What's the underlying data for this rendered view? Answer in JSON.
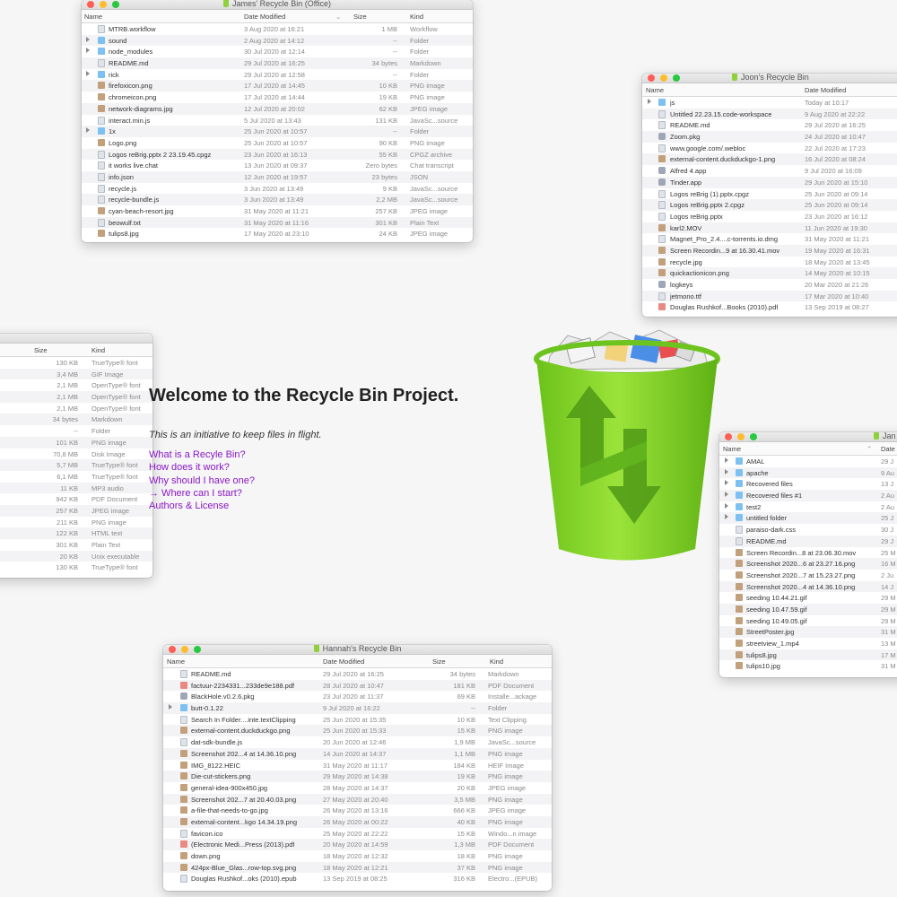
{
  "page": {
    "heading": "Welcome to the Recycle Bin Project.",
    "tagline": "This is an initiative to keep files in flight.",
    "links": [
      "What is a Recyle Bin?",
      "How does it work?",
      "Why should I have one?",
      "→ Where can I start?",
      "Authors & License"
    ],
    "accent_color": "#8a17c7"
  },
  "windows": {
    "james": {
      "title": "James' Recycle Bin (Office)",
      "columns": [
        "Name",
        "Date Modified",
        "Size",
        "Kind"
      ],
      "rows": [
        {
          "icon": "file",
          "name": "MTRB.workflow",
          "date": "3 Aug 2020 at 16:21",
          "size": "1 MB",
          "kind": "Workflow"
        },
        {
          "icon": "folder",
          "name": "sound",
          "date": "2 Aug 2020 at 14:12",
          "size": "--",
          "kind": "Folder"
        },
        {
          "icon": "folder",
          "name": "node_modules",
          "date": "30 Jul 2020 at 12:14",
          "size": "--",
          "kind": "Folder"
        },
        {
          "icon": "file",
          "name": "README.md",
          "date": "29 Jul 2020 at 16:25",
          "size": "34 bytes",
          "kind": "Markdown"
        },
        {
          "icon": "folder",
          "name": "rick",
          "date": "29 Jul 2020 at 12:58",
          "size": "--",
          "kind": "Folder"
        },
        {
          "icon": "img",
          "name": "firefoxicon.png",
          "date": "17 Jul 2020 at 14:45",
          "size": "10 KB",
          "kind": "PNG image"
        },
        {
          "icon": "img",
          "name": "chromeicon.png",
          "date": "17 Jul 2020 at 14:44",
          "size": "19 KB",
          "kind": "PNG image"
        },
        {
          "icon": "img",
          "name": "network-diagrams.jpg",
          "date": "12 Jul 2020 at 20:02",
          "size": "62 KB",
          "kind": "JPEG image"
        },
        {
          "icon": "file",
          "name": "interact.min.js",
          "date": "5 Jul 2020 at 13:43",
          "size": "131 KB",
          "kind": "JavaSc...source"
        },
        {
          "icon": "folder",
          "name": "1x",
          "date": "25 Jun 2020 at 10:57",
          "size": "--",
          "kind": "Folder"
        },
        {
          "icon": "img",
          "name": "Logo.png",
          "date": "25 Jun 2020 at 10:57",
          "size": "90 KB",
          "kind": "PNG image"
        },
        {
          "icon": "file",
          "name": "Logos reBrig.pptx 2 23.19.45.cpgz",
          "date": "23 Jun 2020 at 16:13",
          "size": "55 KB",
          "kind": "CPGZ archive"
        },
        {
          "icon": "file",
          "name": "it works live.chat",
          "date": "13 Jun 2020 at 09:37",
          "size": "Zero bytes",
          "kind": "Chat transcript"
        },
        {
          "icon": "file",
          "name": "info.json",
          "date": "12 Jun 2020 at 19:57",
          "size": "23 bytes",
          "kind": "JSON"
        },
        {
          "icon": "file",
          "name": "recycle.js",
          "date": "3 Jun 2020 at 13:49",
          "size": "9 KB",
          "kind": "JavaSc...source"
        },
        {
          "icon": "file",
          "name": "recycle-bundle.js",
          "date": "3 Jun 2020 at 13:49",
          "size": "2,2 MB",
          "kind": "JavaSc...source"
        },
        {
          "icon": "img",
          "name": "cyan-beach-resort.jpg",
          "date": "31 May 2020 at 11:21",
          "size": "257 KB",
          "kind": "JPEG image"
        },
        {
          "icon": "file",
          "name": "beowulf.txt",
          "date": "31 May 2020 at 11:16",
          "size": "301 KB",
          "kind": "Plain Text"
        },
        {
          "icon": "img",
          "name": "tulips8.jpg",
          "date": "17 May 2020 at 23:10",
          "size": "24 KB",
          "kind": "JPEG image"
        }
      ]
    },
    "joon": {
      "title": "Joon's Recycle Bin",
      "columns": [
        "Name",
        "Date Modified"
      ],
      "rows": [
        {
          "icon": "folder",
          "name": "js",
          "date": "Today at 10:17"
        },
        {
          "icon": "file",
          "name": "Untitled 22.23.15.code-workspace",
          "date": "9 Aug 2020 at 22:22"
        },
        {
          "icon": "file",
          "name": "README.md",
          "date": "29 Jul 2020 at 16:25"
        },
        {
          "icon": "app",
          "name": "Zoom.pkg",
          "date": "24 Jul 2020 at 10:47"
        },
        {
          "icon": "file",
          "name": "www.google.com/.webloc",
          "date": "22 Jul 2020 at 17:23"
        },
        {
          "icon": "img",
          "name": "external-content.duckduckgo-1.png",
          "date": "16 Jul 2020 at 08:24"
        },
        {
          "icon": "app",
          "name": "Alfred 4.app",
          "date": "9 Jul 2020 at 16:09"
        },
        {
          "icon": "app",
          "name": "Tinder.app",
          "date": "29 Jun 2020 at 15:10"
        },
        {
          "icon": "file",
          "name": "Logos reBrig (1).pptx.cpgz",
          "date": "25 Jun 2020 at 09:14"
        },
        {
          "icon": "file",
          "name": "Logos reBrig.pptx 2.cpgz",
          "date": "25 Jun 2020 at 09:14"
        },
        {
          "icon": "file",
          "name": "Logos reBrig.pptx",
          "date": "23 Jun 2020 at 16:12"
        },
        {
          "icon": "img",
          "name": "karl2.MOV",
          "date": "11 Jun 2020 at 19:30"
        },
        {
          "icon": "file",
          "name": "Magnet_Pro_2.4....c-torrents.io.dmg",
          "date": "31 May 2020 at 11:21"
        },
        {
          "icon": "img",
          "name": "Screen Recordin...9 at 16.30.41.mov",
          "date": "19 May 2020 at 16:31"
        },
        {
          "icon": "img",
          "name": "recycle.jpg",
          "date": "18 May 2020 at 13:45"
        },
        {
          "icon": "img",
          "name": "quickactionicon.png",
          "date": "14 May 2020 at 10:15"
        },
        {
          "icon": "app",
          "name": "logkeys",
          "date": "20 Mar 2020 at 21:26"
        },
        {
          "icon": "file",
          "name": "jetmono.ttf",
          "date": "17 Mar 2020 at 10:40"
        },
        {
          "icon": "pdf",
          "name": "Douglas Rushkof...Books (2010).pdf",
          "date": "13 Sep 2019 at 08:27"
        }
      ]
    },
    "left": {
      "columns": [
        "Size",
        "Kind"
      ],
      "rows": [
        {
          "size": "130 KB",
          "kind": "TrueType® font"
        },
        {
          "size": "3,4 MB",
          "kind": "GIF Image"
        },
        {
          "size": "2,1 MB",
          "kind": "OpenType® font"
        },
        {
          "size": "2,1 MB",
          "kind": "OpenType® font"
        },
        {
          "size": "2,1 MB",
          "kind": "OpenType® font"
        },
        {
          "size": "34 bytes",
          "kind": "Markdown"
        },
        {
          "size": "--",
          "kind": "Folder"
        },
        {
          "size": "101 KB",
          "kind": "PNG image"
        },
        {
          "size": "70,8 MB",
          "kind": "Disk Image"
        },
        {
          "size": "5,7 MB",
          "kind": "TrueType® font"
        },
        {
          "size": "6,1 MB",
          "kind": "TrueType® font"
        },
        {
          "size": "11 KB",
          "kind": "MP3 audio"
        },
        {
          "size": "942 KB",
          "kind": "PDF Document"
        },
        {
          "size": "257 KB",
          "kind": "JPEG image"
        },
        {
          "size": "211 KB",
          "kind": "PNG image"
        },
        {
          "size": "122 KB",
          "kind": "HTML text"
        },
        {
          "size": "301 KB",
          "kind": "Plain Text"
        },
        {
          "size": "20 KB",
          "kind": "Unix executable"
        },
        {
          "size": "130 KB",
          "kind": "TrueType® font"
        }
      ]
    },
    "right": {
      "title": "Jan",
      "columns": [
        "Name",
        "Date"
      ],
      "rows": [
        {
          "icon": "folder",
          "name": "AMAL",
          "date": "29 J"
        },
        {
          "icon": "folder",
          "name": "apache",
          "date": "9 Au"
        },
        {
          "icon": "folder",
          "name": "Recovered files",
          "date": "13 J"
        },
        {
          "icon": "folder",
          "name": "Recovered files #1",
          "date": "2 Au"
        },
        {
          "icon": "folder",
          "name": "test2",
          "date": "2 Au"
        },
        {
          "icon": "folder",
          "name": "untitled folder",
          "date": "25 J"
        },
        {
          "icon": "file",
          "name": "paraiso-dark.css",
          "date": "30 J"
        },
        {
          "icon": "file",
          "name": "README.md",
          "date": "29 J"
        },
        {
          "icon": "img",
          "name": "Screen Recordin...8 at 23.06.30.mov",
          "date": "25 M"
        },
        {
          "icon": "img",
          "name": "Screenshot 2020...6 at 23.27.16.png",
          "date": "16 M"
        },
        {
          "icon": "img",
          "name": "Screenshot 2020...7 at 15.23.27.png",
          "date": "2 Ju"
        },
        {
          "icon": "img",
          "name": "Screenshot 2020...4 at 14.36.10.png",
          "date": "14 J"
        },
        {
          "icon": "img",
          "name": "seeding 10.44.21.gif",
          "date": "29 M"
        },
        {
          "icon": "img",
          "name": "seeding 10.47.59.gif",
          "date": "29 M"
        },
        {
          "icon": "img",
          "name": "seeding 10.49.05.gif",
          "date": "29 M"
        },
        {
          "icon": "img",
          "name": "StreetPoster.jpg",
          "date": "31 M"
        },
        {
          "icon": "img",
          "name": "streetview_1.mp4",
          "date": "13 M"
        },
        {
          "icon": "img",
          "name": "tulips8.jpg",
          "date": "17 M"
        },
        {
          "icon": "img",
          "name": "tulips10.jpg",
          "date": "31 M"
        }
      ]
    },
    "hannah": {
      "title": "Hannah's Recycle Bin",
      "columns": [
        "Name",
        "Date Modified",
        "Size",
        "Kind"
      ],
      "rows": [
        {
          "icon": "file",
          "name": "README.md",
          "date": "29 Jul 2020 at 16:25",
          "size": "34 bytes",
          "kind": "Markdown"
        },
        {
          "icon": "pdf",
          "name": "factuur-2234331...233de9e188.pdf",
          "date": "28 Jul 2020 at 10:47",
          "size": "181 KB",
          "kind": "PDF Document"
        },
        {
          "icon": "app",
          "name": "BlackHole.v0.2.6.pkg",
          "date": "23 Jul 2020 at 11:37",
          "size": "69 KB",
          "kind": "Installe...ackage"
        },
        {
          "icon": "folder",
          "name": "butt-0.1.22",
          "date": "9 Jul 2020 at 16:22",
          "size": "--",
          "kind": "Folder"
        },
        {
          "icon": "file",
          "name": "Search In Folder....inte.textClipping",
          "date": "25 Jun 2020 at 15:35",
          "size": "10 KB",
          "kind": "Text Clipping"
        },
        {
          "icon": "img",
          "name": "external-content.duckduckgo.png",
          "date": "25 Jun 2020 at 15:33",
          "size": "15 KB",
          "kind": "PNG image"
        },
        {
          "icon": "file",
          "name": "dat-sdk-bundle.js",
          "date": "20 Jun 2020 at 12:46",
          "size": "1,9 MB",
          "kind": "JavaSc...source"
        },
        {
          "icon": "img",
          "name": "Screenshot 202...4 at 14.36.10.png",
          "date": "14 Jun 2020 at 14:37",
          "size": "1,1 MB",
          "kind": "PNG image"
        },
        {
          "icon": "img",
          "name": "IMG_8122.HEIC",
          "date": "31 May 2020 at 11:17",
          "size": "184 KB",
          "kind": "HEIF Image"
        },
        {
          "icon": "img",
          "name": "Die-cut-stickers.png",
          "date": "29 May 2020 at 14:38",
          "size": "19 KB",
          "kind": "PNG image"
        },
        {
          "icon": "img",
          "name": "general-idea-900x450.jpg",
          "date": "28 May 2020 at 14:37",
          "size": "20 KB",
          "kind": "JPEG image"
        },
        {
          "icon": "img",
          "name": "Screenshot 202...7 at 20.40.03.png",
          "date": "27 May 2020 at 20:40",
          "size": "3,5 MB",
          "kind": "PNG image"
        },
        {
          "icon": "img",
          "name": "a-file-that-needs-to-go.jpg",
          "date": "26 May 2020 at 13:16",
          "size": "666 KB",
          "kind": "JPEG image"
        },
        {
          "icon": "img",
          "name": "external-content...kgo 14.34.19.png",
          "date": "26 May 2020 at 00:22",
          "size": "40 KB",
          "kind": "PNG image"
        },
        {
          "icon": "file",
          "name": "favicon.ico",
          "date": "25 May 2020 at 22:22",
          "size": "15 KB",
          "kind": "Windo...n image"
        },
        {
          "icon": "pdf",
          "name": "(Electronic Medi...Press (2013).pdf",
          "date": "20 May 2020 at 14:59",
          "size": "1,3 MB",
          "kind": "PDF Document"
        },
        {
          "icon": "img",
          "name": "down.png",
          "date": "18 May 2020 at 12:32",
          "size": "18 KB",
          "kind": "PNG image"
        },
        {
          "icon": "img",
          "name": "424px-Blue_Glas...row-top.svg.png",
          "date": "18 May 2020 at 12:21",
          "size": "37 KB",
          "kind": "PNG image"
        },
        {
          "icon": "file",
          "name": "Douglas Rushkof...oks (2010).epub",
          "date": "13 Sep 2019 at 08:25",
          "size": "316 KB",
          "kind": "Electro...(EPUB)"
        }
      ]
    }
  }
}
